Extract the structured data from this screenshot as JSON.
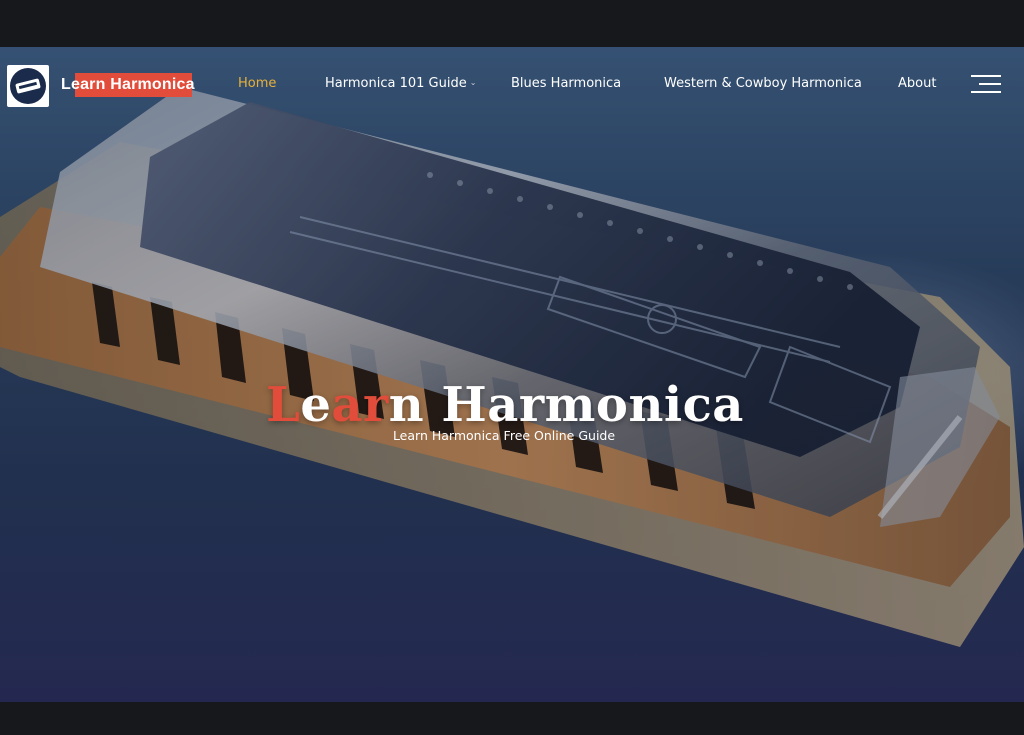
{
  "header": {
    "site_title_prefix": "Le",
    "site_title_rest": "arn Harmonica",
    "logo_icon": "harmonica-icon",
    "menu_icon": "hamburger-menu-icon"
  },
  "nav": {
    "items": [
      {
        "label": "Home",
        "active": true
      },
      {
        "label": "Harmonica 101 Guide",
        "has_dropdown": true
      },
      {
        "label": "Blues Harmonica"
      },
      {
        "label": "Western & Cowboy Harmonica"
      },
      {
        "label": "About"
      }
    ]
  },
  "hero": {
    "title_part1": "L",
    "title_part2": "e",
    "title_part3": "ar",
    "title_part4": "n Harmonica",
    "subtitle": "Learn Harmonica Free Online Guide",
    "background_icon": "harmonica-photo"
  },
  "colors": {
    "accent_red": "#e14d3a",
    "nav_active": "#e8b03a",
    "frame_dark": "#17181c",
    "logo_navy": "#1b2b4b"
  }
}
